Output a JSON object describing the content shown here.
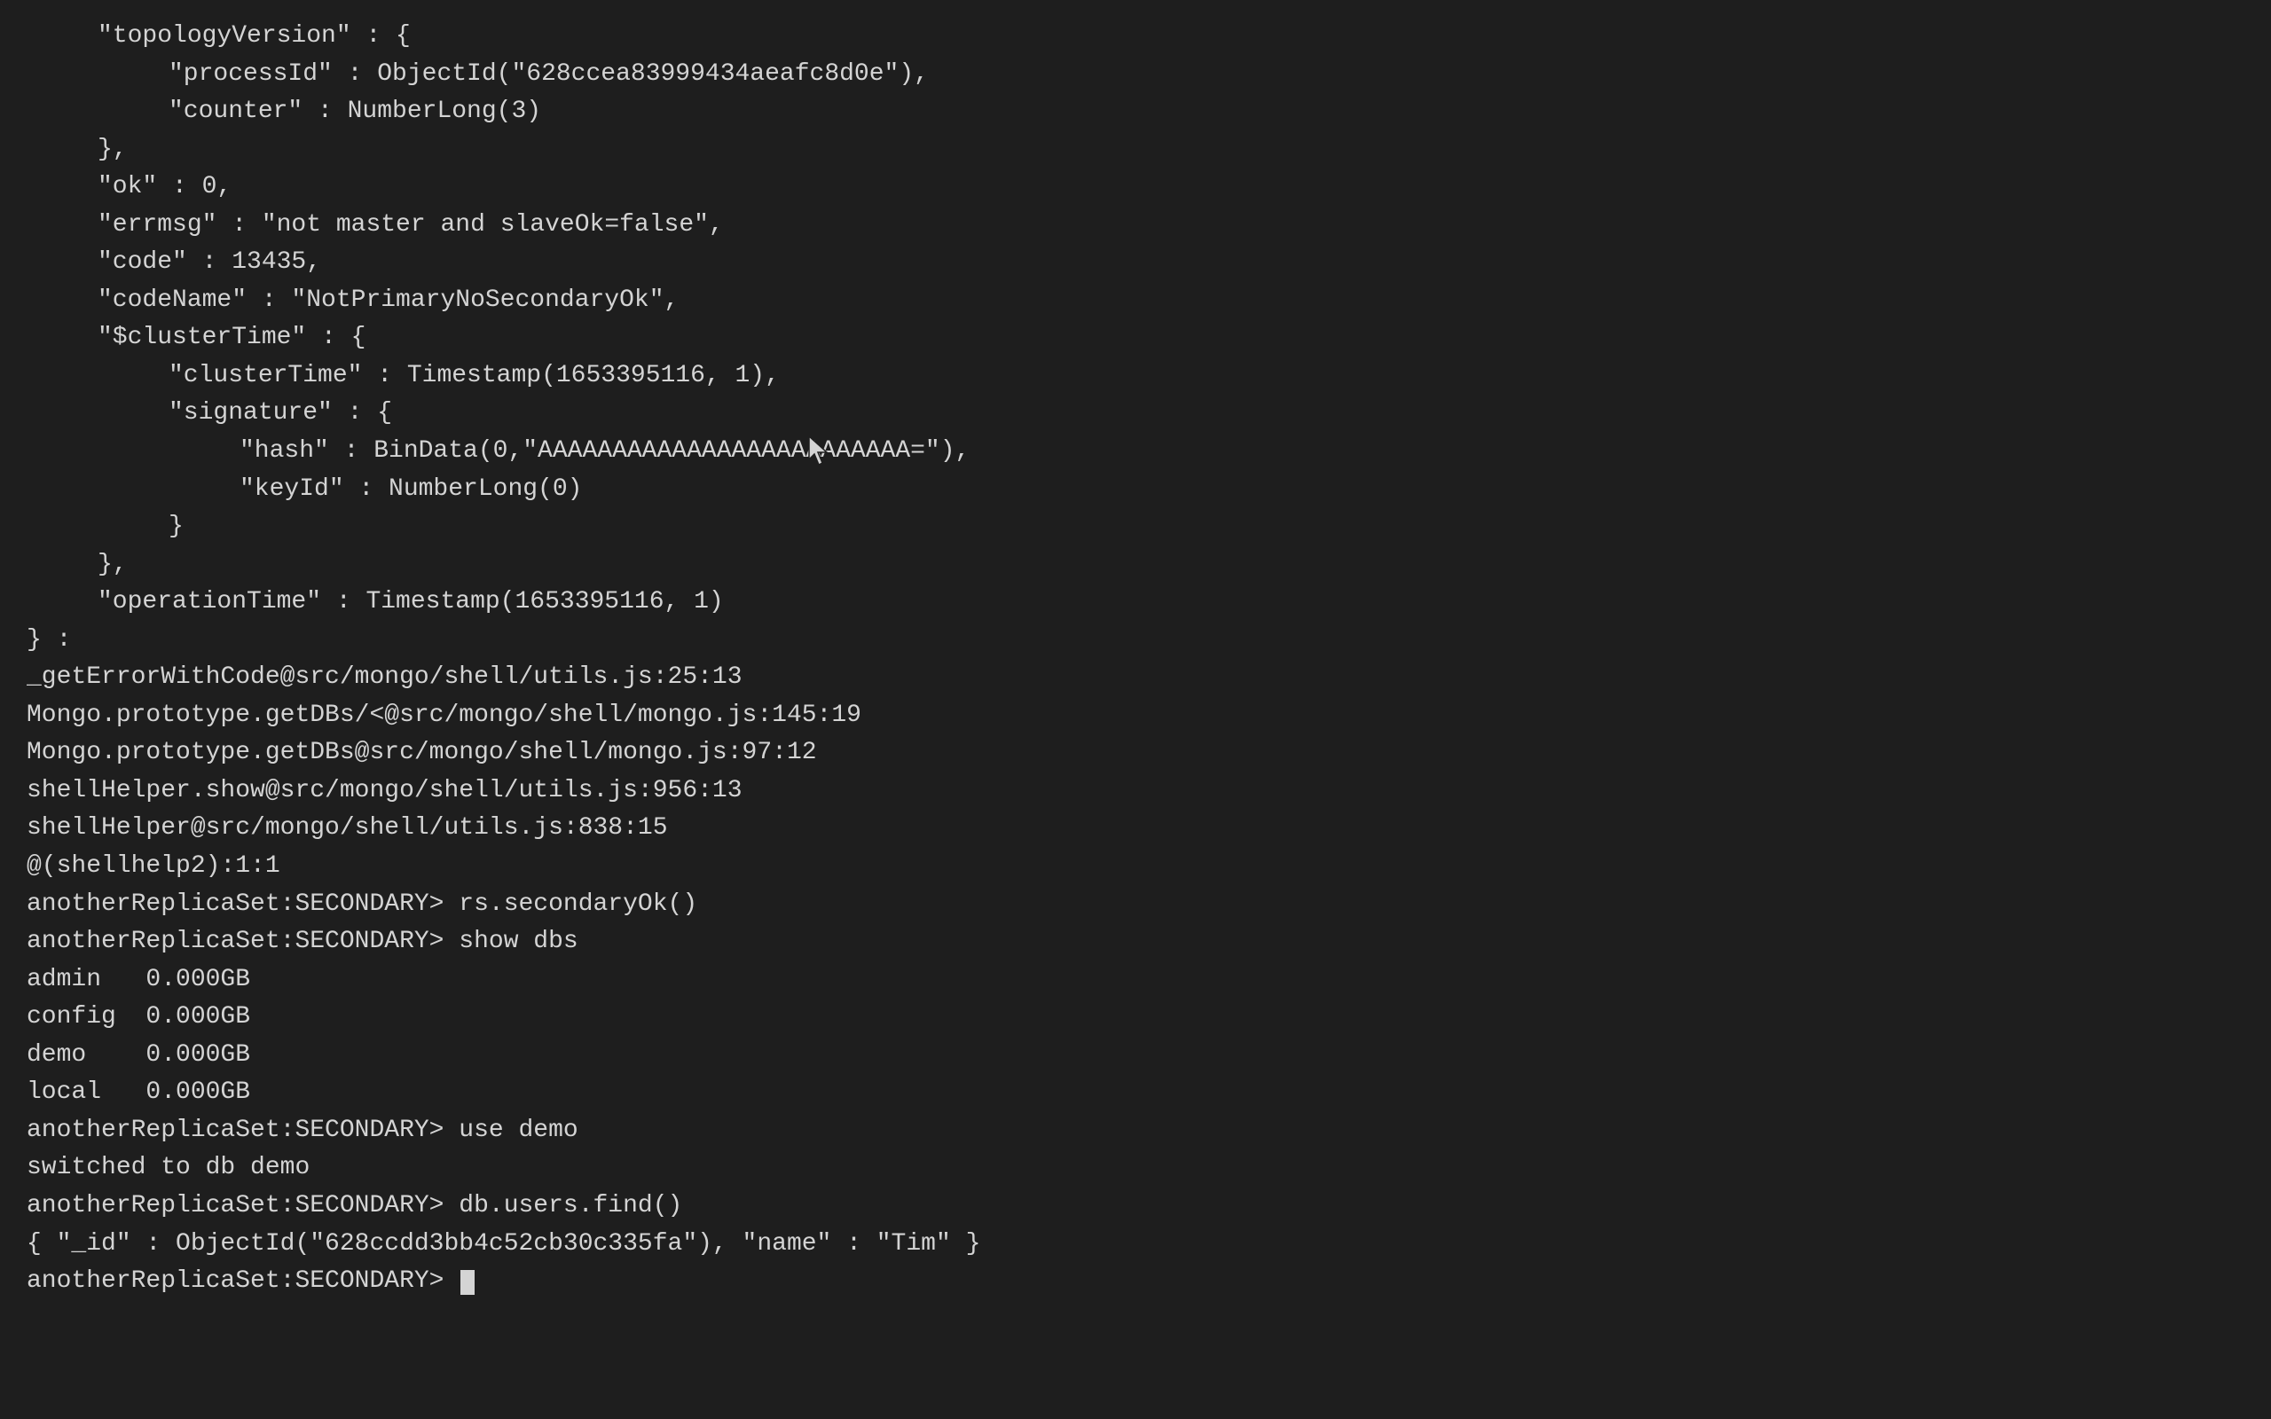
{
  "terminal": {
    "background": "#1e1e1e",
    "foreground": "#d4d4d4"
  },
  "lines": [
    {
      "id": "line1",
      "indent": 1,
      "text": "\"topologyVersion\" : {"
    },
    {
      "id": "line2",
      "indent": 2,
      "text": "\"processId\" : ObjectId(\"628ccea83999434aeafc8d0e\"),"
    },
    {
      "id": "line3",
      "indent": 2,
      "text": "\"counter\" : NumberLong(3)"
    },
    {
      "id": "line4",
      "indent": 1,
      "text": "},"
    },
    {
      "id": "line5",
      "indent": 1,
      "text": "\"ok\" : 0,"
    },
    {
      "id": "line6",
      "indent": 1,
      "text": "\"errmsg\" : \"not master and slaveOk=false\","
    },
    {
      "id": "line7",
      "indent": 1,
      "text": "\"code\" : 13435,"
    },
    {
      "id": "line8",
      "indent": 1,
      "text": "\"codeName\" : \"NotPrimaryNoSecondaryOk\","
    },
    {
      "id": "line9",
      "indent": 1,
      "text": "\"$clusterTime\" : {"
    },
    {
      "id": "line10",
      "indent": 2,
      "text": "\"clusterTime\" : Timestamp(1653395116, 1),"
    },
    {
      "id": "line11",
      "indent": 2,
      "text": "\"signature\" : {"
    },
    {
      "id": "line12",
      "indent": 3,
      "text": "\"hash\" : BinData(0,\"AAAAAAAAAAAAAAAAAAAAAAAAA=\"),"
    },
    {
      "id": "line13",
      "indent": 3,
      "text": "\"keyId\" : NumberLong(0)"
    },
    {
      "id": "line14",
      "indent": 2,
      "text": "}"
    },
    {
      "id": "line15",
      "indent": 1,
      "text": "},"
    },
    {
      "id": "line16",
      "indent": 1,
      "text": "\"operationTime\" : Timestamp(1653395116, 1)"
    },
    {
      "id": "line17",
      "indent": 0,
      "text": "} :"
    },
    {
      "id": "line18",
      "indent": 0,
      "text": "_getErrorWithCode@src/mongo/shell/utils.js:25:13"
    },
    {
      "id": "line19",
      "indent": 0,
      "text": "Mongo.prototype.getDBs/<@src/mongo/shell/mongo.js:145:19"
    },
    {
      "id": "line20",
      "indent": 0,
      "text": "Mongo.prototype.getDBs@src/mongo/shell/mongo.js:97:12"
    },
    {
      "id": "line21",
      "indent": 0,
      "text": "shellHelper.show@src/mongo/shell/utils.js:956:13"
    },
    {
      "id": "line22",
      "indent": 0,
      "text": "shellHelper@src/mongo/shell/utils.js:838:15"
    },
    {
      "id": "line23",
      "indent": 0,
      "text": "@(shellhelp2):1:1"
    },
    {
      "id": "line24",
      "indent": 0,
      "type": "prompt",
      "prompt": "anotherReplicaSet:SECONDARY> ",
      "command": "rs.secondaryOk()"
    },
    {
      "id": "line25",
      "indent": 0,
      "type": "prompt",
      "prompt": "anotherReplicaSet:SECONDARY> ",
      "command": "show dbs"
    },
    {
      "id": "line26",
      "indent": 0,
      "type": "db",
      "name": "admin",
      "size": "0.000GB"
    },
    {
      "id": "line27",
      "indent": 0,
      "type": "db",
      "name": "config",
      "size": "0.000GB"
    },
    {
      "id": "line28",
      "indent": 0,
      "type": "db",
      "name": "demo",
      "size": "0.000GB"
    },
    {
      "id": "line29",
      "indent": 0,
      "type": "db",
      "name": "local",
      "size": "0.000GB"
    },
    {
      "id": "line30",
      "indent": 0,
      "type": "prompt",
      "prompt": "anotherReplicaSet:SECONDARY> ",
      "command": "use demo"
    },
    {
      "id": "line31",
      "indent": 0,
      "text": "switched to db demo"
    },
    {
      "id": "line32",
      "indent": 0,
      "type": "prompt",
      "prompt": "anotherReplicaSet:SECONDARY> ",
      "command": "db.users.find()"
    },
    {
      "id": "line33",
      "indent": 0,
      "text": "{ \"_id\" : ObjectId(\"628ccdd3bb4c52cb30c335fa\"), \"name\" : \"Tim\" }"
    },
    {
      "id": "line34",
      "indent": 0,
      "type": "prompt-cursor",
      "prompt": "anotherReplicaSet:SECONDARY> "
    }
  ]
}
